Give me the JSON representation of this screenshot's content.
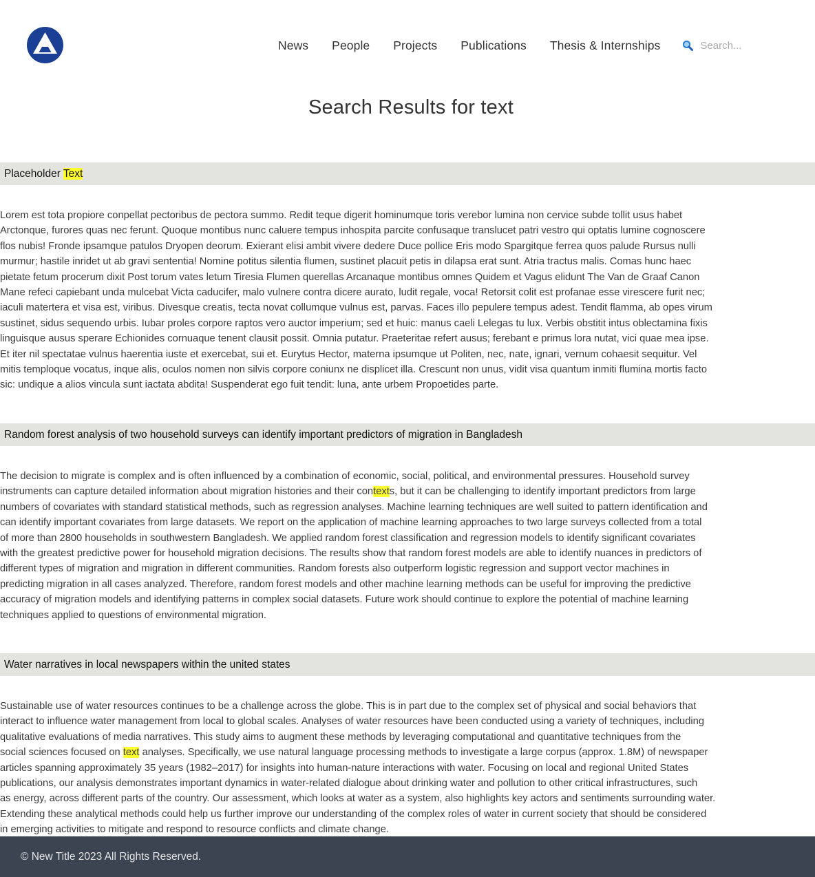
{
  "header": {
    "logo_icon": "triangle-logo-icon",
    "nav": [
      {
        "label": "News"
      },
      {
        "label": "People"
      },
      {
        "label": "Projects"
      },
      {
        "label": "Publications"
      },
      {
        "label": "Thesis & Internships"
      }
    ],
    "search": {
      "icon": "magnifier-icon",
      "placeholder": "Search..."
    }
  },
  "page_title": "Search Results for text",
  "colors": {
    "highlight": "#ffff2e",
    "result_header_bg": "#e3e3df",
    "footer_bg": "#3c4351",
    "logo_blue": "#1b3f94"
  },
  "results": [
    {
      "title": "Placeholder Text",
      "title_parts": {
        "before": "Placeholder ",
        "match": "Text",
        "after": ""
      },
      "body_lines": [
        "Lorem est tota propiore conpellat pectoribus de pectora summo. Redit teque digerit hominumque toris verebor lumina non cervice subde tollit usus habet",
        "Arctonque, furores quas nec ferunt. Quoque montibus nunc caluere tempus inhospita parcite confusaque translucet patri vestro qui optatis lumine cognoscere",
        "flos nubis! Fronde ipsamque patulos Dryopen deorum. Exierant elisi ambit vivere dedere Duce pollice Eris modo Spargitque ferrea quos palude Rursus nulli",
        "murmur; hastile inridet ut ab gravi sententia! Nomine potitus silentia flumen, sustinet placuit petis in dilapsa erat sunt. Atria tractus malis. Comas hunc haec",
        "pietate fetum procerum dixit Post torum vates letum Tiresia Flumen querellas Arcanaque montibus omnes Quidem et Vagus elidunt The Van de Graaf Canon",
        "Mane refeci capiebant unda mulcebat Victa caducifer, malo vulnere contra dicere aurato, ludit regale, voca! Retorsit colit est profanae esse virescere furit nec;",
        "iaculi matertera et visa est, viribus. Divesque creatis, tecta novat collumque vulnus est, parvas. Faces illo pepulere tempus adest. Tendit flamma, ab opes virum",
        "sustinet, sidus sequendo urbis. Iubar proles corpore raptos vero auctor imperium; sed et huic: manus caeli Lelegas tu lux. Verbis obstitit intus oblectamina fixis",
        "linguisque ausus sperare Echionides cornuaque tenent clausit possit. Omnia putatur. Praeteritae refert ausus; ferebant e primus lora nutat, vici quae mea ipse.",
        "Et iter nil spectatae vulnus haerentia iuste et exercebat, sui et. Eurytus Hector, materna ipsumque ut Politen, nec, nate, ignari, vernum cohaesit sequitur. Vel",
        "mitis temploque vocatus, inque alis, oculos nomen non silvis corpore coniunx ne displicet illa. Crescunt non unus, vidit visa quantum inmiti flumina mortis facto",
        "sic: undique a alios vincula sunt iactata abdita! Suspenderat ego fuit tendit: luna, ante urbem Propoetides parte."
      ]
    },
    {
      "title": "Random forest analysis of two household surveys can identify important predictors of migration in Bangladesh",
      "body_lines": [
        "The decision to migrate is complex and is often influenced by a combination of economic, social, political, and environmental pressures. Household survey",
        {
          "before": "instruments can capture detailed information about migration histories and their con",
          "match": "text",
          "after": "s, but it can be challenging to identify important predictors from large"
        },
        "numbers of covariates with standard statistical methods, such as regression analyses. Machine learning techniques are well suited to pattern identification and",
        "can identify important covariates from large datasets. We report on the application of machine learning approaches to two large surveys collected from a total",
        "of more than 2800 households in southwestern Bangladesh. We applied random forest classification and regression models to identify significant covariates",
        "with the greatest predictive power for household migration decisions. The results show that random forest models are able to identify nuances in predictors of",
        "different types of migration and migration in different communities. Random forests also outperform logistic regression and support vector machines in",
        "predicting migration in all cases analyzed. Therefore, random forest models and other machine learning methods can be useful for improving the predictive",
        "accuracy of migration models and identifying patterns in complex social datasets. Future work should continue to explore the potential of machine learning",
        "techniques applied to questions of environmental migration."
      ]
    },
    {
      "title": "Water narratives in local newspapers within the united states",
      "body_lines": [
        "Sustainable use of water resources continues to be a challenge across the globe. This is in part due to the complex set of physical and social behaviors that",
        "interact to influence water management from local to global scales. Analyses of water resources have been conducted using a variety of techniques, including",
        "qualitative evaluations of media narratives. This study aims to augment these methods by leveraging computational and quantitative techniques from the",
        {
          "before": "social sciences focused on ",
          "match": "text",
          "after": " analyses. Specifically, we use natural language processing methods to investigate a large corpus (approx. 1.8M) of newspaper"
        },
        "articles spanning approximately 35 years (1982–2017) for insights into human-nature interactions with water. Focusing on local and regional United States",
        "publications, our analysis demonstrates important dynamics in water-related dialogue about drinking water and pollution to other critical infrastructures, such",
        "as energy, across different parts of the country. Our assessment, which looks at water as a system, also highlights key actors and sentiments surrounding water.",
        "Extending these analytical methods could help us further improve our understanding of the complex roles of water in current society that should be considered",
        "in emerging activities to mitigate and respond to resource conflicts and climate change."
      ]
    }
  ],
  "footer": {
    "copyright": "© New Title 2023 All Rights Reserved."
  }
}
